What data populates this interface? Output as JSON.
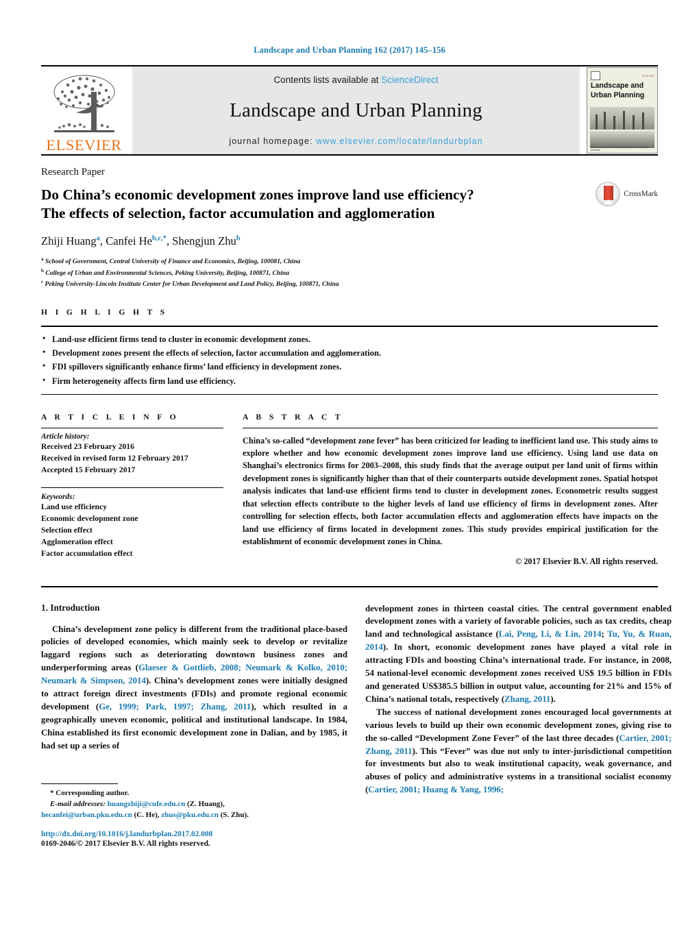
{
  "running_head": "Landscape and Urban Planning 162 (2017) 145–156",
  "masthead": {
    "publisher_logo_text": "ELSEVIER",
    "contents_prefix": "Contents lists available at ",
    "contents_link": "ScienceDirect",
    "journal_name": "Landscape and Urban Planning",
    "homepage_prefix": "journal homepage: ",
    "homepage_link": "www.elsevier.com/locate/landurbplan",
    "cover": {
      "title_line1": "Landscape and",
      "title_line2": "Urban Planning",
      "corner_text": "ELSEVIER",
      "foot_text": "Official Journal of the International Federation of Landscape Architects"
    }
  },
  "article": {
    "kicker": "Research Paper",
    "title_line1": "Do China’s economic development zones improve land use efficiency?",
    "title_line2": "The effects of selection, factor accumulation and agglomeration",
    "crossmark_label": "CrossMark",
    "authors": [
      {
        "name": "Zhiji Huang",
        "sup": "a",
        "sep": ", "
      },
      {
        "name": "Canfei He",
        "sup": "b,c,",
        "star": "*",
        "sep": ", "
      },
      {
        "name": "Shengjun Zhu",
        "sup": "b",
        "sep": ""
      }
    ],
    "affiliations": [
      {
        "mark": "a",
        "text": "School of Government, Central University of Finance and Economics, Beijing, 100081, China"
      },
      {
        "mark": "b",
        "text": "College of Urban and Environmental Sciences, Peking University, Beijing, 100871, China"
      },
      {
        "mark": "c",
        "text": "Peking University-Lincoln Institute Center for Urban Development and Land Policy, Beijing, 100871, China"
      }
    ]
  },
  "highlights": {
    "label": "H I G H L I G H T S",
    "items": [
      "Land-use efficient firms tend to cluster in economic development zones.",
      "Development zones present the effects of selection, factor accumulation and agglomeration.",
      "FDI spillovers significantly enhance firms’ land efficiency in development zones.",
      "Firm heterogeneity affects firm land use efficiency."
    ]
  },
  "article_info": {
    "label": "A R T I C L E   I N F O",
    "history_title": "Article history:",
    "history": [
      "Received 23 February 2016",
      "Received in revised form 12 February 2017",
      "Accepted 15 February 2017"
    ],
    "keywords_title": "Keywords:",
    "keywords": [
      "Land use efficiency",
      "Economic development zone",
      "Selection effect",
      "Agglomeration effect",
      "Factor accumulation effect"
    ]
  },
  "abstract": {
    "label": "A B S T R A C T",
    "text": "China’s so-called “development zone fever” has been criticized for leading to inefficient land use. This study aims to explore whether and how economic development zones improve land use efficiency. Using land use data on Shanghai’s electronics firms for 2003–2008, this study finds that the average output per land unit of firms within development zones is significantly higher than that of their counterparts outside development zones. Spatial hotspot analysis indicates that land-use efficient firms tend to cluster in development zones. Econometric results suggest that selection effects contribute to the higher levels of land use efficiency of firms in development zones. After controlling for selection effects, both factor accumulation effects and agglomeration effects have impacts on the land use efficiency of firms located in development zones. This study provides empirical justification for the establishment of economic development zones in China.",
    "copyright": "© 2017 Elsevier B.V. All rights reserved."
  },
  "body": {
    "section_heading": "1.  Introduction",
    "left_para_1_a": "China’s development zone policy is different from the traditional place-based policies of developed economies, which mainly seek to develop or revitalize laggard regions such as deteriorating downtown business zones and underperforming areas (",
    "left_para_1_cite1": "Glaeser & Gottlieb, 2008; Neumark & Kolko, 2010; Neumark & Simpson, 2014",
    "left_para_1_b": "). China’s development zones were initially designed to attract foreign direct investments (FDIs) and promote regional economic development (",
    "left_para_1_cite2": "Ge, 1999; Park, 1997; Zhang, 2011",
    "left_para_1_c": "), which resulted in a geographically uneven economic, political and institutional landscape. In 1984, China established its first economic development zone in Dalian, and by 1985, it had set up a series of",
    "right_para_1_a": "development zones in thirteen coastal cities. The central government enabled development zones with a variety of favorable policies, such as tax credits, cheap land and technological assistance (",
    "right_para_1_cite1": "Lai, Peng, Li, & Lin, 2014",
    "right_para_1_mid": "; ",
    "right_para_1_cite2": "Tu, Yu, & Ruan, 2014",
    "right_para_1_b": "). In short, economic development zones have played a vital role in attracting FDIs and boosting China’s international trade. For instance, in 2008, 54 national-level economic development zones received US$ 19.5 billion in FDIs and generated US$385.5 billion in output value, accounting for 21% and 15% of China’s national totals, respectively (",
    "right_para_1_cite3": "Zhang, 2011",
    "right_para_1_c": ").",
    "right_para_2_a": "The success of national development zones encouraged local governments at various levels to build up their own economic development zones, giving rise to the so-called “Development Zone Fever” of the last three decades (",
    "right_para_2_cite1": "Cartier, 2001; Zhang, 2011",
    "right_para_2_b": "). This “Fever” was due not only to inter-jurisdictional competition for investments but also to weak institutional capacity, weak governance, and abuses of policy and administrative systems in a transitional socialist economy (",
    "right_para_2_cite2": "Cartier, 2001; Huang & Yang, 1996;",
    "right_para_2_c": ""
  },
  "footnote": {
    "corresponding": "*  Corresponding author.",
    "email_label": "E-mail addresses:",
    "email_1": "huangzhiji@cufe.edu.cn",
    "email_1_owner": " (Z. Huang),",
    "email_2": "hecanfei@urban.pku.edu.cn",
    "email_2_owner": " (C. He), ",
    "email_3": "zhus@pku.edu.cn",
    "email_3_owner": " (S. Zhu)."
  },
  "doi_block": {
    "doi": "http://dx.doi.org/10.1016/j.landurbplan.2017.02.008",
    "issn": "0169-2046/© 2017 Elsevier B.V. All rights reserved."
  },
  "colors": {
    "link_blue": "#1a7bb0",
    "sd_blue": "#3a9fd4",
    "elsevier_orange": "#E9711C",
    "panel_gray": "#e6e7e8"
  }
}
